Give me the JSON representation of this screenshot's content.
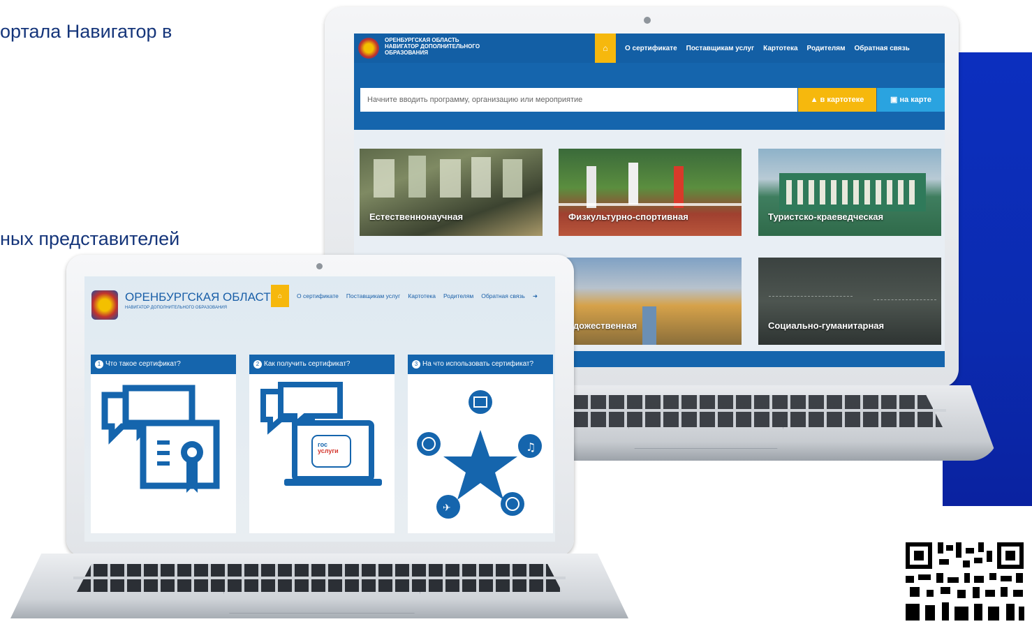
{
  "slide": {
    "line1": "ортала Навигатор в",
    "line2": "ных представителей"
  },
  "colors": {
    "nav_blue": "#135fa5",
    "accent_yellow": "#f6b80d",
    "map_btn_blue": "#2aa3e0",
    "side_panel": "#0c2fbf"
  },
  "back_screen": {
    "logo_line1": "ОРЕНБУРГСКАЯ ОБЛАСТЬ",
    "logo_line2": "НАВИГАТОР ДОПОЛНИТЕЛЬНОГО",
    "logo_line3": "ОБРАЗОВАНИЯ",
    "nav": [
      "О сертификате",
      "Поставщикам услуг",
      "Картотека",
      "Родителям",
      "Обратная связь"
    ],
    "search_placeholder": "Начните вводить программу, организацию или мероприятие",
    "btn_catalog": "в картотеке",
    "btn_map": "на карте",
    "cards": [
      {
        "label": "Естественнонаучная"
      },
      {
        "label": "Физкультурно-спортивная"
      },
      {
        "label": "Туристско-краеведческая"
      },
      {
        "label": "удожественная"
      },
      {
        "label": "Социально-гуманитарная"
      }
    ]
  },
  "front_screen": {
    "logo_title": "ОРЕНБУРГСКАЯ ОБЛАСТЬ",
    "logo_subtitle": "НАВИГАТОР ДОПОЛНИТЕЛЬНОГО ОБРАЗОВАНИЯ",
    "nav": [
      "О сертификате",
      "Поставщикам услуг",
      "Картотека",
      "Родителям",
      "Обратная связь"
    ],
    "panels": [
      {
        "num": "1",
        "title": "Что такое сертификат?"
      },
      {
        "num": "2",
        "title": "Как получить сертификат?"
      },
      {
        "num": "3",
        "title": "На что использовать сертификат?"
      }
    ],
    "gosuslugi_line1": "гос",
    "gosuslugi_line2": "услуги"
  }
}
